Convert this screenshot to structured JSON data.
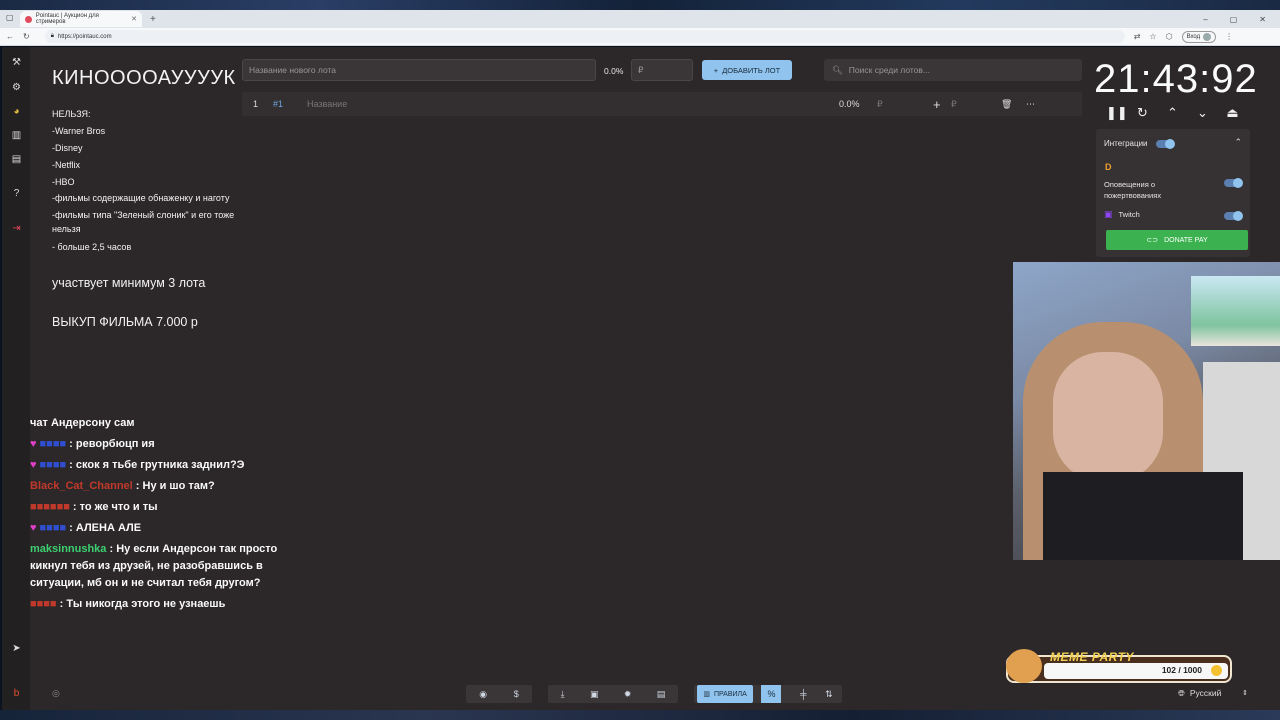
{
  "browser": {
    "tab_title": "Pointauc | Аукцион для стримеров",
    "url": "https://pointauc.com",
    "profile_label": "Вход"
  },
  "rules": {
    "title": "КИНООООАУУУУК",
    "lines": [
      "НЕЛЬЗЯ:",
      "-Warner Bros",
      "-Disney",
      "-Netflix",
      "-HBO",
      "-фильмы содержащие обнаженку и наготу",
      "-фильмы типа \"Зеленый слоник\" и его тоже нельзя",
      "- больше 2,5 часов"
    ],
    "min_lots": "участвует минимум 3 лота",
    "buyout": "ВЫКУП ФИЛЬМА 7.000 р"
  },
  "toolbar": {
    "new_lot_placeholder": "Название нового лота",
    "percent": "0.0%",
    "currency_symbol": "₽",
    "add_lot_label": "ДОБАВИТЬ ЛОТ",
    "search_placeholder": "Поиск среди лотов..."
  },
  "lots": [
    {
      "index": "1",
      "id": "#1",
      "name_placeholder": "Название",
      "percent": "0.0%",
      "currency": "₽"
    }
  ],
  "timer": {
    "display": "21:43:92"
  },
  "integrations": {
    "title": "Интеграции",
    "donations_label": "Оповещения о пожертвованиях",
    "twitch_label": "Twitch",
    "donate_pay_label": "DONATE PAY"
  },
  "chat": [
    {
      "user": "",
      "user_color": "#c0392b",
      "badge": false,
      "text": "чат Андерсону сам"
    },
    {
      "user": "",
      "user_color": "#2f4fd0",
      "badge": true,
      "text": "реворбюцп ия"
    },
    {
      "user": "",
      "user_color": "#2f4fd0",
      "badge": true,
      "text": "скок я тьбе грутника заднил?Э"
    },
    {
      "user": "Black_Cat_Channel",
      "user_color": "#c0392b",
      "badge": false,
      "text": "Ну и шо там?"
    },
    {
      "user": "",
      "user_color": "#c0392b",
      "badge": false,
      "text": "то же что и ты"
    },
    {
      "user": "",
      "user_color": "#2f4fd0",
      "badge": true,
      "text": "АЛЕНА АЛЕ"
    },
    {
      "user": "maksinnushka",
      "user_color": "#3cd070",
      "badge": false,
      "text": "Ну если Андерсон так просто кикнул тебя из друзей, не разобравшись в ситуации, мб он и не считал тебя другом?"
    },
    {
      "user": "",
      "user_color": "#c0392b",
      "badge": false,
      "text": "Ты никогда этого не узнаешь"
    }
  ],
  "bottom": {
    "rules_label": "ПРАВИЛА"
  },
  "meme_party": {
    "title": "MEME PARTY",
    "progress": "102 / 1000"
  },
  "language": {
    "selected": "Русский"
  },
  "colors": {
    "accent": "#90c4ee",
    "donate_green": "#3bb24f",
    "app_bg": "#2c2729"
  }
}
